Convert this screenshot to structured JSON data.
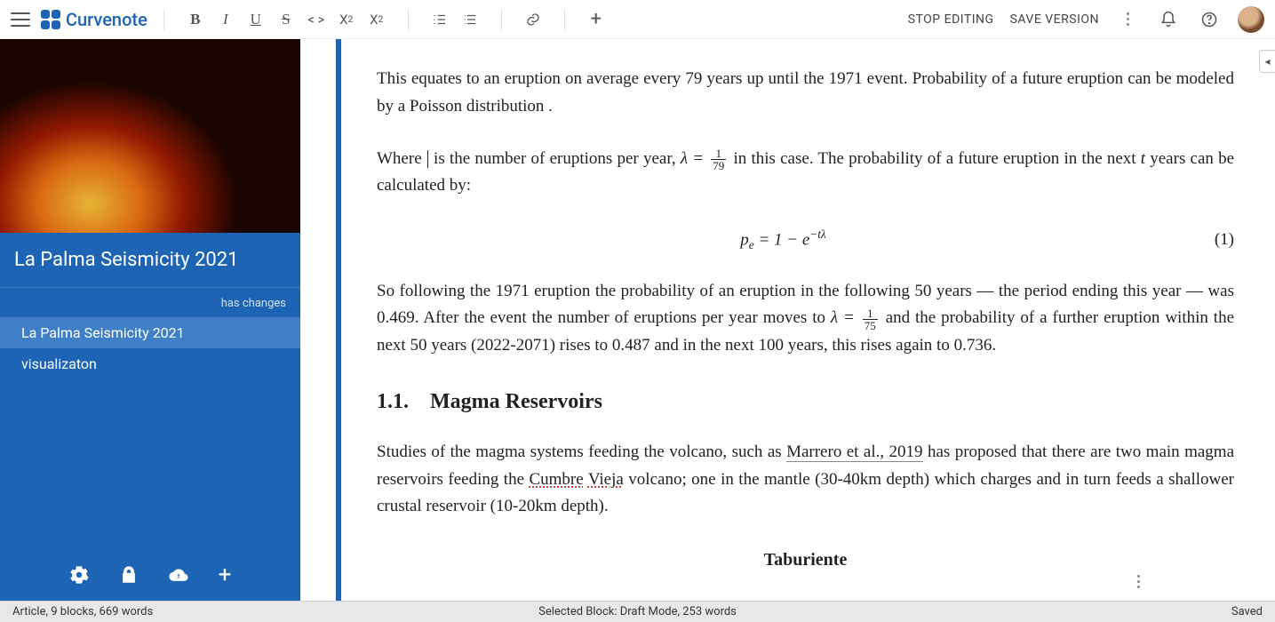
{
  "brand": "Curvenote",
  "toolbar": {
    "bold": "B",
    "italic": "I",
    "underline": "U",
    "strike": "S",
    "code": "< >",
    "subscript": "X",
    "subscript_sub": "2",
    "superscript": "X",
    "superscript_sup": "2",
    "add": "+"
  },
  "actions": {
    "stop_editing": "STOP EDITING",
    "save_version": "SAVE VERSION"
  },
  "sidebar": {
    "project_title": "La Palma Seismicity 2021",
    "changes_label": "has changes",
    "items": [
      {
        "label": "La Palma Seismicity 2021",
        "active": true
      },
      {
        "label": "visualizaton",
        "active": false
      }
    ]
  },
  "document": {
    "p1": "This equates to an eruption on average every 79 years up until the 1971 event. Probability of a future eruption can be modeled by a Poisson distribution .",
    "p2_a": "Where",
    "p2_b": "is the number of eruptions per year, ",
    "p2_lambda": "λ = ",
    "p2_frac_num": "1",
    "p2_frac_den": "79",
    "p2_c": " in this case. The probability of a future eruption in the next ",
    "p2_t": "t",
    "p2_d": " years can be calculated by:",
    "eq_lhs_var": "p",
    "eq_lhs_sub": "e",
    "eq_eq": " = 1 − e",
    "eq_exp": "−tλ",
    "eq_num": "(1)",
    "p3_a": "So following the 1971 eruption the probability of an eruption in the following 50 years — the period ending this year — was 0.469. After the event the number of eruptions per year moves to ",
    "p3_lambda": "λ = ",
    "p3_frac_num": "1",
    "p3_frac_den": "75",
    "p3_b": " and the probability of a further eruption within the next 50 years (2022-2071) rises to 0.487 and in the next 100 years, this rises again to 0.736.",
    "h2": "1.1. Magma Reservoirs",
    "p4_a": "Studies of the magma systems feeding the volcano, such as ",
    "p4_cite": "Marrero et al., 2019",
    "p4_b": " has proposed that there are two main magma reservoirs feeding the ",
    "p4_name1": "Cumbre",
    "p4_name2": "Vieja",
    "p4_c": " volcano; one in the mantle (30-40km depth) which charges and in turn feeds a shallower crustal reservoir (10-20km depth).",
    "trunc_heading": "Taburiente"
  },
  "statusbar": {
    "left": "Article, 9 blocks, 669 words",
    "center": "Selected Block: Draft Mode, 253 words",
    "right": "Saved"
  },
  "collapse_glyph": "◂"
}
